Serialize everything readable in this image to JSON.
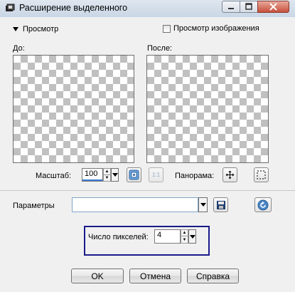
{
  "window": {
    "title": "Расширение выделенного"
  },
  "preview": {
    "toggle_label": "Просмотр",
    "image_preview_label": "Просмотр изображения",
    "image_preview_checked": false,
    "before_label": "До:",
    "after_label": "После:"
  },
  "zoom": {
    "label": "Масштаб:",
    "value": "100",
    "ratio_label": "1:1"
  },
  "pan": {
    "label": "Панорама:"
  },
  "params": {
    "label": "Параметры",
    "value": ""
  },
  "pixels": {
    "label": "Число пикселей:",
    "value": "4"
  },
  "buttons": {
    "ok": "OK",
    "cancel": "Отмена",
    "help": "Справка"
  },
  "colors": {
    "accent": "#1b1b8a",
    "checker": "#c0c0c0",
    "close_button": "#c7503a"
  }
}
